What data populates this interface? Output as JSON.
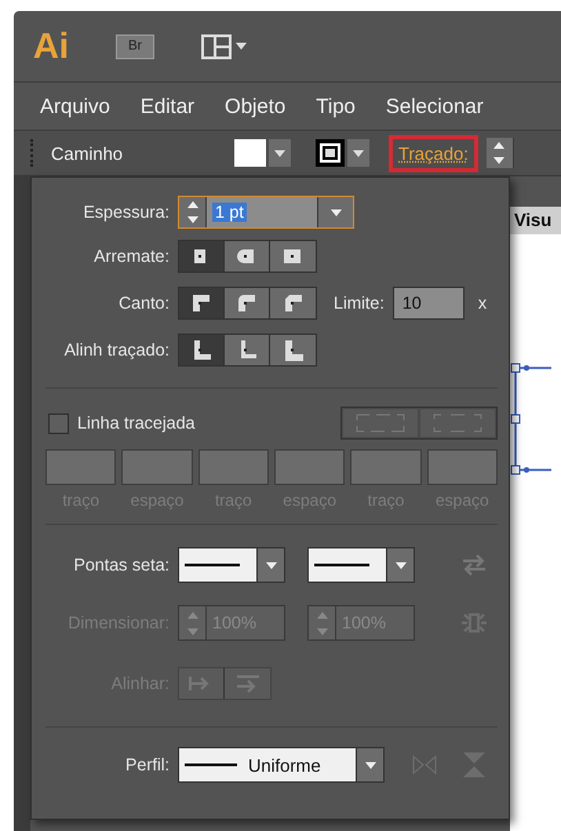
{
  "app_bar": {
    "logo": "Ai",
    "bridge": "Br"
  },
  "menu": [
    "Arquivo",
    "Editar",
    "Objeto",
    "Tipo",
    "Selecionar"
  ],
  "control_bar": {
    "label": "Caminho",
    "stroke_link": {
      "label": "Traçado:",
      "highlighted": true
    }
  },
  "document_tab": "Visu",
  "stroke_panel": {
    "weight": {
      "label": "Espessura:",
      "value": "1 pt"
    },
    "cap": {
      "label": "Arremate:",
      "options": [
        {
          "kind": "butt",
          "selected": true
        },
        {
          "kind": "round",
          "selected": false
        },
        {
          "kind": "square",
          "selected": false
        }
      ]
    },
    "corner": {
      "label": "Canto:",
      "options": [
        {
          "kind": "miter",
          "selected": true
        },
        {
          "kind": "round",
          "selected": false
        },
        {
          "kind": "bevel",
          "selected": false
        }
      ],
      "limit_label": "Limite:",
      "limit_value": "10",
      "limit_unit": "x"
    },
    "align": {
      "label": "Alinh traçado:",
      "options": [
        {
          "kind": "center",
          "selected": true
        },
        {
          "kind": "inside",
          "selected": false
        },
        {
          "kind": "outside",
          "selected": false
        }
      ]
    },
    "dashed": {
      "label": "Linha tracejada",
      "checked": false
    },
    "dash_fields": {
      "disabled": true,
      "labels": [
        "traço",
        "espaço",
        "traço",
        "espaço",
        "traço",
        "espaço"
      ]
    },
    "arrowheads": {
      "label": "Pontas seta:"
    },
    "scale": {
      "label": "Dimensionar:",
      "disabled": true,
      "values": [
        "100%",
        "100%"
      ]
    },
    "arrow_align": {
      "label": "Alinhar:",
      "disabled": true
    },
    "profile": {
      "label": "Perfil:",
      "value": "Uniforme"
    }
  }
}
